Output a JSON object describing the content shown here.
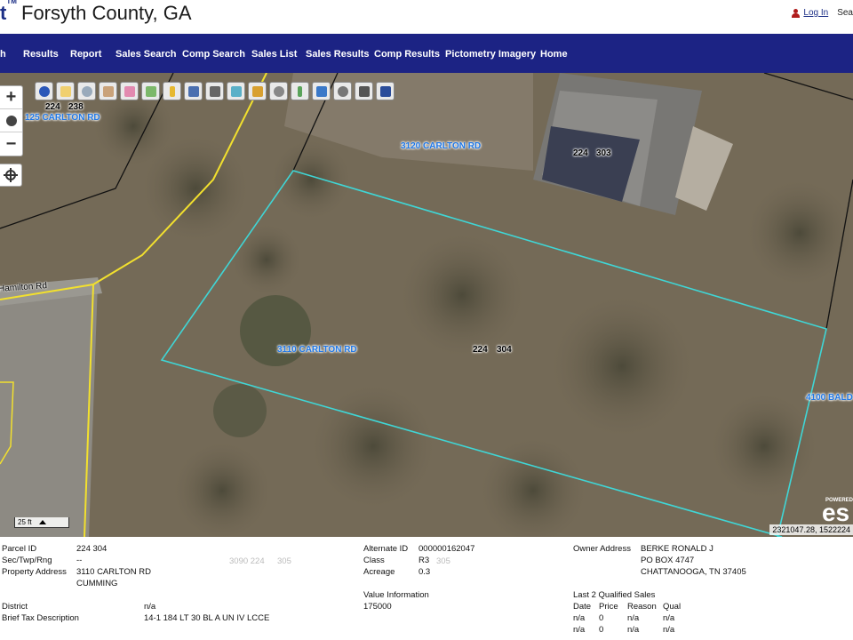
{
  "header": {
    "logo_fragment": "t",
    "trademark": "TM",
    "county": "Forsyth County, GA",
    "login": "Log In",
    "search_fragment": "Sea"
  },
  "nav": [
    {
      "label": "h",
      "id": "search-fragment"
    },
    {
      "label": "Results",
      "id": "results"
    },
    {
      "label": "Report",
      "id": "report"
    },
    {
      "label": "Sales Search",
      "id": "sales-search"
    },
    {
      "label": "Comp Search",
      "id": "comp-search"
    },
    {
      "label": "Sales List",
      "id": "sales-list"
    },
    {
      "label": "Sales Results",
      "id": "sales-results"
    },
    {
      "label": "Comp Results",
      "id": "comp-results"
    },
    {
      "label": "Pictometry Imagery",
      "id": "pictometry-imagery"
    },
    {
      "label": "Home",
      "id": "home"
    }
  ],
  "map": {
    "zoom_in": "+",
    "zoom_out": "−",
    "tools": [
      "info-icon",
      "highlight-icon",
      "zoom-area-icon",
      "pan-hand-icon",
      "eraser-icon",
      "select-icon",
      "marker-icon",
      "layers-icon",
      "camera-icon",
      "map-icon",
      "buildings-icon",
      "magnify-icon",
      "pencil-icon",
      "identify-icon",
      "settings-icon",
      "print-icon",
      "save-icon"
    ],
    "labels": {
      "carlton_125": "125 CARLTON RD",
      "pin_224_238_a": "224",
      "pin_224_238_b": "238",
      "carlton_3120": "3120 CARLTON RD",
      "pin_224_303_a": "224",
      "pin_224_303_b": "303",
      "hamilton": "Hamilton Rd",
      "carlton_3110": "3110 CARLTON RD",
      "pin_224_304_a": "224",
      "pin_224_304_b": "304",
      "bald_4100": "4100 BALD"
    },
    "scale": "25 ft",
    "esri_powered": "POWERED",
    "esri": "es",
    "coordinates": "2321047.28, 1522224"
  },
  "parcel": {
    "parcel_id_label": "Parcel ID",
    "parcel_id": "224 304",
    "sec_label": "Sec/Twp/Rng",
    "sec": "--",
    "address_label": "Property Address",
    "address_line1": "3110 CARLTON RD",
    "address_line2": "CUMMING",
    "district_label": "District",
    "district": "n/a",
    "brief_tax_label": "Brief Tax Description",
    "brief_tax": "14-1 184 LT 30 BL A UN IV LCCE",
    "alt_id_label": "Alternate ID",
    "alt_id": "000000162047",
    "class_label": "Class",
    "class": "R3",
    "acreage_label": "Acreage",
    "acreage": "0.3",
    "value_info_label": "Value Information",
    "value": "175000",
    "owner_label": "Owner Address",
    "owner_name": "BERKE RONALD J",
    "owner_po": "PO BOX 4747",
    "owner_city": "CHATTANOOGA, TN 37405",
    "sales_label": "Last 2 Qualified Sales",
    "sales_headers": [
      "Date",
      "Price",
      "Reason",
      "Qual"
    ],
    "sales_rows": [
      [
        "n/a",
        "0",
        "n/a",
        "n/a"
      ],
      [
        "n/a",
        "0",
        "n/a",
        "n/a"
      ]
    ],
    "ghost_label_a": "3090 224",
    "ghost_label_b": "305",
    "ghost_label_c": "305"
  }
}
